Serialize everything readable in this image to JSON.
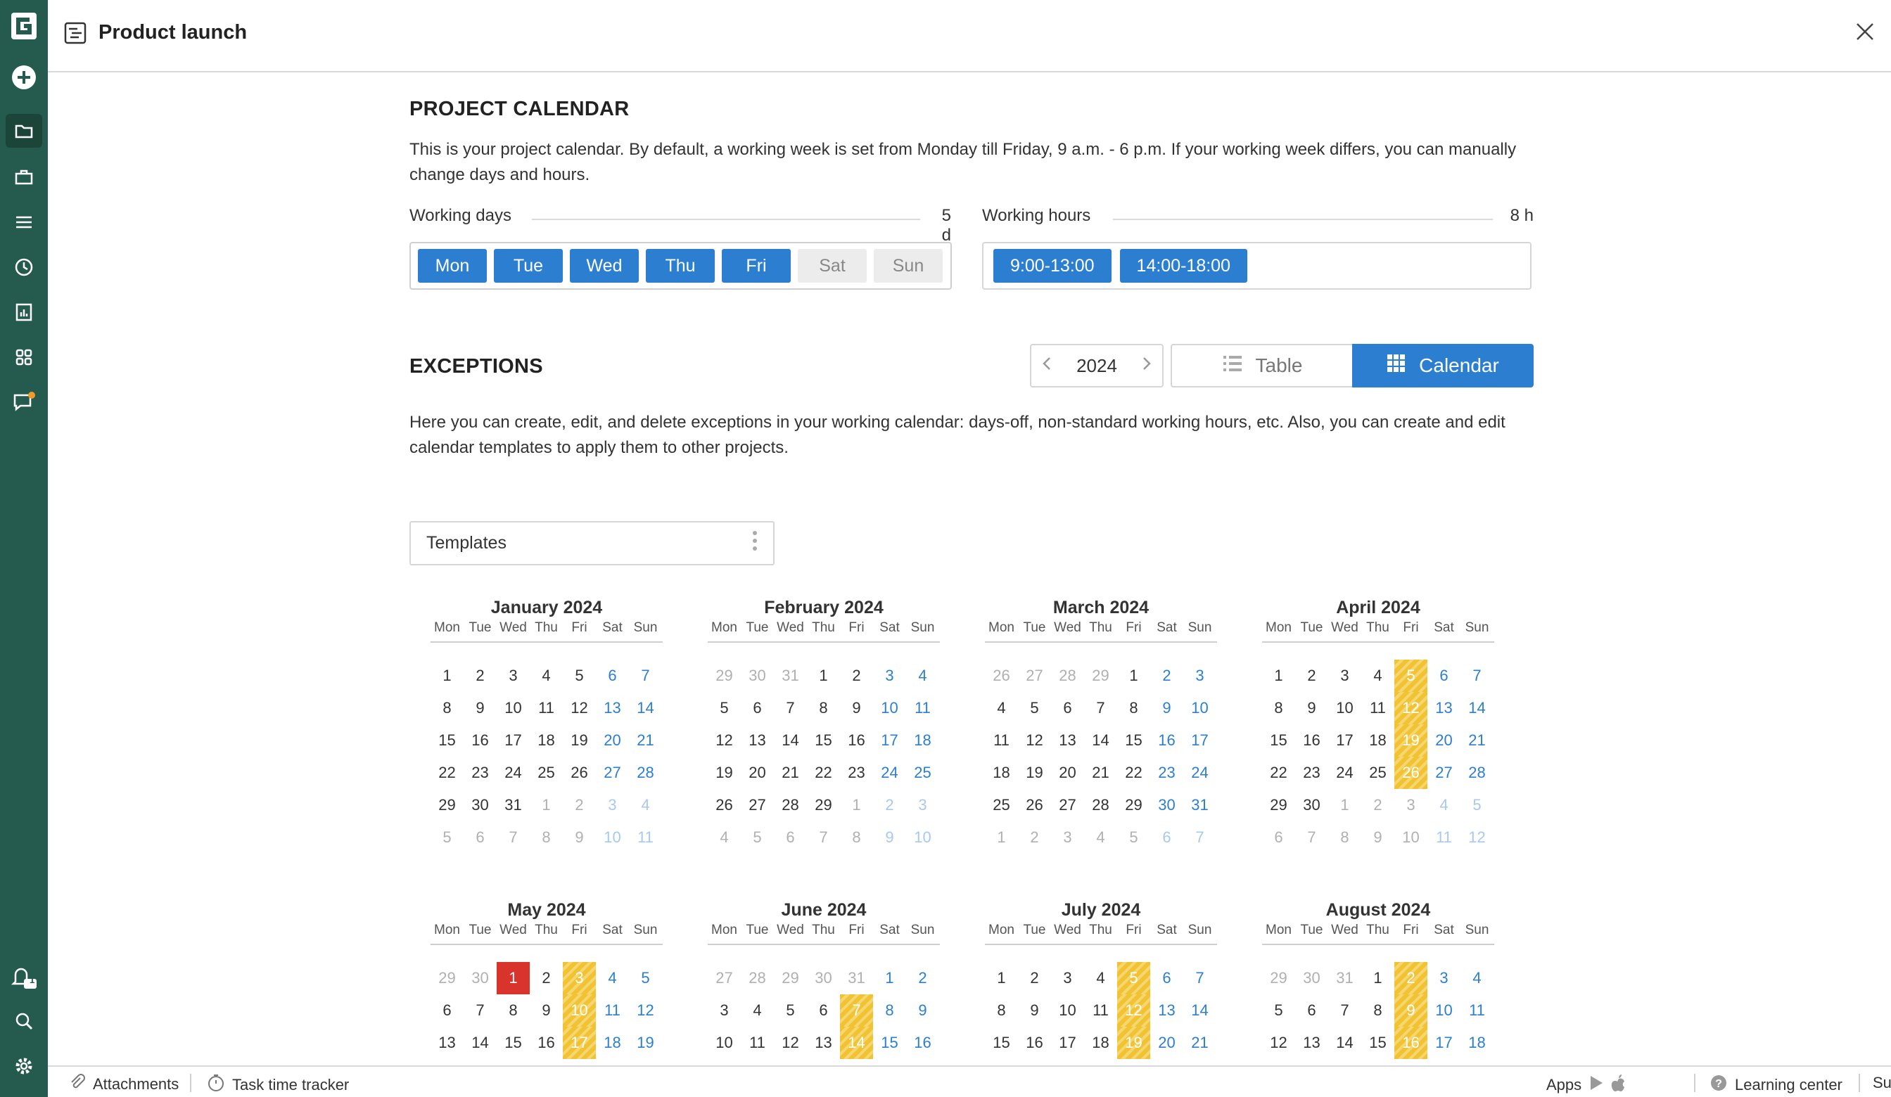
{
  "app": {
    "title": "Product launch"
  },
  "calendar_section": {
    "heading": "PROJECT CALENDAR",
    "description": "This is your project calendar. By default, a working week is set from Monday till Friday, 9 a.m. - 6 p.m. If your working week differs, you can manually change days and hours.",
    "working_days_label": "Working days",
    "working_days_value": "5 d",
    "working_hours_label": "Working hours",
    "working_hours_value": "8 h",
    "days": [
      {
        "label": "Mon",
        "active": true
      },
      {
        "label": "Tue",
        "active": true
      },
      {
        "label": "Wed",
        "active": true
      },
      {
        "label": "Thu",
        "active": true
      },
      {
        "label": "Fri",
        "active": true
      },
      {
        "label": "Sat",
        "active": false
      },
      {
        "label": "Sun",
        "active": false
      }
    ],
    "hours": [
      "9:00-13:00",
      "14:00-18:00"
    ]
  },
  "exceptions": {
    "heading": "EXCEPTIONS",
    "year": "2024",
    "view_table_label": "Table",
    "view_calendar_label": "Calendar",
    "active_view": "Calendar",
    "description": "Here you can create, edit, and delete exceptions in your working calendar: days-off, non-standard working hours, etc. Also, you can create and edit calendar templates to apply them to other projects.",
    "templates_label": "Templates"
  },
  "weekday_headers": [
    "Mon",
    "Tue",
    "Wed",
    "Thu",
    "Fri",
    "Sat",
    "Sun"
  ],
  "months": [
    {
      "title": "January 2024",
      "weeks": [
        [
          "1",
          "2",
          "3",
          "4",
          "5",
          "6",
          "7"
        ],
        [
          "8",
          "9",
          "10",
          "11",
          "12",
          "13",
          "14"
        ],
        [
          "15",
          "16",
          "17",
          "18",
          "19",
          "20",
          "21"
        ],
        [
          "22",
          "23",
          "24",
          "25",
          "26",
          "27",
          "28"
        ],
        [
          "29",
          "30",
          "31",
          "1",
          "2",
          "3",
          "4"
        ],
        [
          "5",
          "6",
          "7",
          "8",
          "9",
          "10",
          "11"
        ]
      ],
      "lead": 0,
      "trail_from": 31,
      "highlights": [],
      "red": []
    },
    {
      "title": "February 2024",
      "weeks": [
        [
          "29",
          "30",
          "31",
          "1",
          "2",
          "3",
          "4"
        ],
        [
          "5",
          "6",
          "7",
          "8",
          "9",
          "10",
          "11"
        ],
        [
          "12",
          "13",
          "14",
          "15",
          "16",
          "17",
          "18"
        ],
        [
          "19",
          "20",
          "21",
          "22",
          "23",
          "24",
          "25"
        ],
        [
          "26",
          "27",
          "28",
          "29",
          "1",
          "2",
          "3"
        ],
        [
          "4",
          "5",
          "6",
          "7",
          "8",
          "9",
          "10"
        ]
      ],
      "lead": 3,
      "trail_from": 32,
      "highlights": [],
      "red": []
    },
    {
      "title": "March 2024",
      "weeks": [
        [
          "26",
          "27",
          "28",
          "29",
          "1",
          "2",
          "3"
        ],
        [
          "4",
          "5",
          "6",
          "7",
          "8",
          "9",
          "10"
        ],
        [
          "11",
          "12",
          "13",
          "14",
          "15",
          "16",
          "17"
        ],
        [
          "18",
          "19",
          "20",
          "21",
          "22",
          "23",
          "24"
        ],
        [
          "25",
          "26",
          "27",
          "28",
          "29",
          "30",
          "31"
        ],
        [
          "1",
          "2",
          "3",
          "4",
          "5",
          "6",
          "7"
        ]
      ],
      "lead": 4,
      "trail_from": 35,
      "highlights": [],
      "red": []
    },
    {
      "title": "April 2024",
      "weeks": [
        [
          "1",
          "2",
          "3",
          "4",
          "5",
          "6",
          "7"
        ],
        [
          "8",
          "9",
          "10",
          "11",
          "12",
          "13",
          "14"
        ],
        [
          "15",
          "16",
          "17",
          "18",
          "19",
          "20",
          "21"
        ],
        [
          "22",
          "23",
          "24",
          "25",
          "26",
          "27",
          "28"
        ],
        [
          "29",
          "30",
          "1",
          "2",
          "3",
          "4",
          "5"
        ],
        [
          "6",
          "7",
          "8",
          "9",
          "10",
          "11",
          "12"
        ]
      ],
      "lead": 0,
      "trail_from": 30,
      "highlights": [
        "5",
        "12",
        "19",
        "26"
      ],
      "red": []
    },
    {
      "title": "May 2024",
      "weeks": [
        [
          "29",
          "30",
          "1",
          "2",
          "3",
          "4",
          "5"
        ],
        [
          "6",
          "7",
          "8",
          "9",
          "10",
          "11",
          "12"
        ],
        [
          "13",
          "14",
          "15",
          "16",
          "17",
          "18",
          "19"
        ]
      ],
      "lead": 2,
      "trail_from": 99,
      "highlights": [
        "3",
        "10",
        "17"
      ],
      "red": [
        "1"
      ]
    },
    {
      "title": "June 2024",
      "weeks": [
        [
          "27",
          "28",
          "29",
          "30",
          "31",
          "1",
          "2"
        ],
        [
          "3",
          "4",
          "5",
          "6",
          "7",
          "8",
          "9"
        ],
        [
          "10",
          "11",
          "12",
          "13",
          "14",
          "15",
          "16"
        ]
      ],
      "lead": 5,
      "trail_from": 99,
      "highlights": [
        "7",
        "14"
      ],
      "red": []
    },
    {
      "title": "July 2024",
      "weeks": [
        [
          "1",
          "2",
          "3",
          "4",
          "5",
          "6",
          "7"
        ],
        [
          "8",
          "9",
          "10",
          "11",
          "12",
          "13",
          "14"
        ],
        [
          "15",
          "16",
          "17",
          "18",
          "19",
          "20",
          "21"
        ]
      ],
      "lead": 0,
      "trail_from": 99,
      "highlights": [
        "5",
        "12",
        "19"
      ],
      "red": []
    },
    {
      "title": "August 2024",
      "weeks": [
        [
          "29",
          "30",
          "31",
          "1",
          "2",
          "3",
          "4"
        ],
        [
          "5",
          "6",
          "7",
          "8",
          "9",
          "10",
          "11"
        ],
        [
          "12",
          "13",
          "14",
          "15",
          "16",
          "17",
          "18"
        ]
      ],
      "lead": 3,
      "trail_from": 99,
      "highlights": [
        "2",
        "9",
        "16"
      ],
      "red": []
    }
  ],
  "footer": {
    "attachments": "Attachments",
    "task_time_tracker": "Task time tracker",
    "apps": "Apps",
    "learning_center": "Learning center",
    "support": "Support"
  },
  "notifications_count": "1",
  "colors": {
    "sidebar": "#245b4e",
    "accent": "#2c7fd0",
    "highlight": "#f1c232",
    "red": "#d9342b"
  }
}
